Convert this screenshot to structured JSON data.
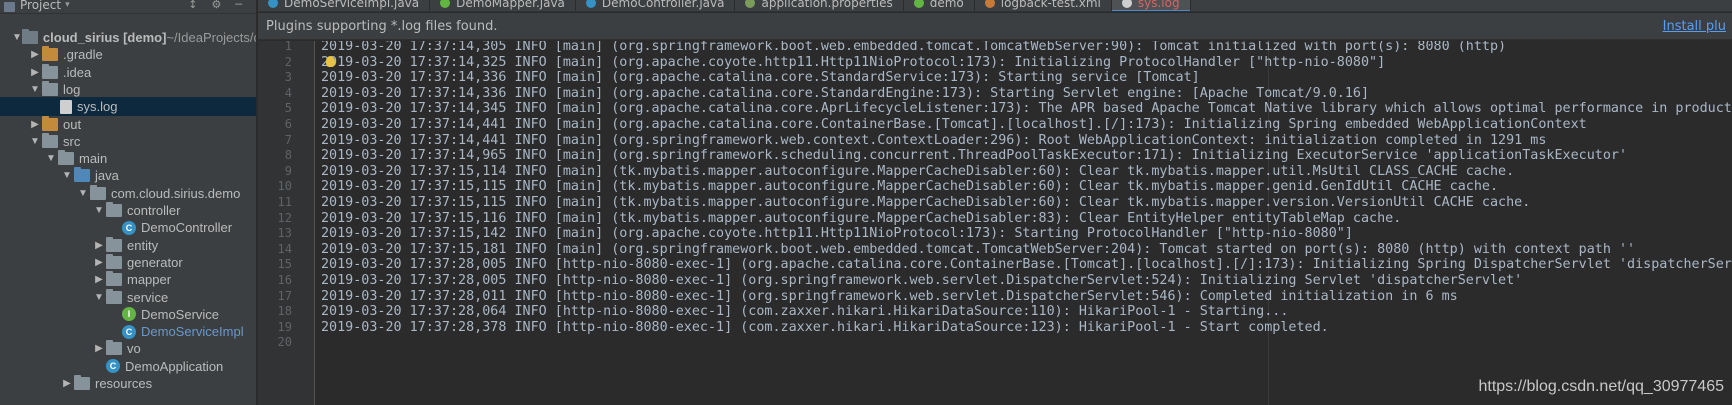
{
  "project_panel": {
    "title": "Project",
    "caret": "▾",
    "tools": [
      "↕",
      "⚙",
      "─"
    ],
    "tree": [
      {
        "depth": 0,
        "arrow": "down",
        "icon": "folder-dark-icon",
        "label": "cloud_sirius [demo]",
        "suffix": " ~/IdeaProjects/clo",
        "style": "bold"
      },
      {
        "depth": 1,
        "arrow": "right",
        "icon": "folder-orange-icon",
        "label": ".gradle"
      },
      {
        "depth": 1,
        "arrow": "right",
        "icon": "folder-icon",
        "label": ".idea"
      },
      {
        "depth": 1,
        "arrow": "down",
        "icon": "folder-icon",
        "label": "log"
      },
      {
        "depth": 2,
        "arrow": "none",
        "icon": "log-file-icon",
        "label": "sys.log",
        "selected": true
      },
      {
        "depth": 1,
        "arrow": "right",
        "icon": "folder-orange-icon",
        "label": "out"
      },
      {
        "depth": 1,
        "arrow": "down",
        "icon": "folder-icon",
        "label": "src"
      },
      {
        "depth": 2,
        "arrow": "down",
        "icon": "folder-icon",
        "label": "main"
      },
      {
        "depth": 3,
        "arrow": "down",
        "icon": "folder-blue-icon",
        "label": "java"
      },
      {
        "depth": 4,
        "arrow": "down",
        "icon": "package-icon",
        "label": "com.cloud.sirius.demo"
      },
      {
        "depth": 5,
        "arrow": "down",
        "icon": "package-icon",
        "label": "controller"
      },
      {
        "depth": 6,
        "arrow": "none",
        "icon": "class-icon",
        "label": "DemoController"
      },
      {
        "depth": 5,
        "arrow": "right",
        "icon": "package-icon",
        "label": "entity"
      },
      {
        "depth": 5,
        "arrow": "right",
        "icon": "package-icon",
        "label": "generator"
      },
      {
        "depth": 5,
        "arrow": "right",
        "icon": "package-icon",
        "label": "mapper"
      },
      {
        "depth": 5,
        "arrow": "down",
        "icon": "package-icon",
        "label": "service"
      },
      {
        "depth": 6,
        "arrow": "none",
        "icon": "interface-icon",
        "label": "DemoService"
      },
      {
        "depth": 6,
        "arrow": "none",
        "icon": "class-icon",
        "label": "DemoServiceImpl",
        "style": "modified"
      },
      {
        "depth": 5,
        "arrow": "right",
        "icon": "package-icon",
        "label": "vo"
      },
      {
        "depth": 5,
        "arrow": "none",
        "icon": "spring-boot-class-icon",
        "label": "DemoApplication"
      },
      {
        "depth": 3,
        "arrow": "right",
        "icon": "folder-icon",
        "label": "resources"
      }
    ]
  },
  "tabs": [
    {
      "label": "DemoServiceImpl.java",
      "icon": "class-icon",
      "color": "#3592c4",
      "active": false
    },
    {
      "label": "DemoMapper.java",
      "icon": "interface-icon",
      "color": "#62b543",
      "active": false
    },
    {
      "label": "DemoController.java",
      "icon": "class-icon",
      "color": "#3592c4",
      "active": false
    },
    {
      "label": "application.properties",
      "icon": "properties-icon",
      "color": "#7b9b5a",
      "active": false
    },
    {
      "label": "demo",
      "icon": "run-config-icon",
      "color": "#62b543",
      "active": false
    },
    {
      "label": "logback-test.xml",
      "icon": "xml-icon",
      "color": "#c67a3a",
      "active": false
    },
    {
      "label": "sys.log",
      "icon": "log-file-icon",
      "color": "#cfcfcf",
      "active": true
    }
  ],
  "notification": {
    "message": "Plugins supporting *.log files found.",
    "action": "Install plu"
  },
  "editor": {
    "line_numbers": [
      "1",
      "2",
      "3",
      "4",
      "5",
      "6",
      "7",
      "8",
      "9",
      "10",
      "11",
      "12",
      "13",
      "14",
      "15",
      "16",
      "17",
      "18",
      "19",
      "20"
    ],
    "lines": [
      "2019-03-20 17:37:14,305 INFO [main] (org.springframework.boot.web.embedded.tomcat.TomcatWebServer:90): Tomcat initialized with port(s): 8080 (http)",
      "2019-03-20 17:37:14,325 INFO [main] (org.apache.coyote.http11.Http11NioProtocol:173): Initializing ProtocolHandler [\"http-nio-8080\"]",
      "2019-03-20 17:37:14,336 INFO [main] (org.apache.catalina.core.StandardService:173): Starting service [Tomcat]",
      "2019-03-20 17:37:14,336 INFO [main] (org.apache.catalina.core.StandardEngine:173): Starting Servlet engine: [Apache Tomcat/9.0.16]",
      "2019-03-20 17:37:14,345 INFO [main] (org.apache.catalina.core.AprLifecycleListener:173): The APR based Apache Tomcat Native library which allows optimal performance in productio",
      "2019-03-20 17:37:14,441 INFO [main] (org.apache.catalina.core.ContainerBase.[Tomcat].[localhost].[/]:173): Initializing Spring embedded WebApplicationContext",
      "2019-03-20 17:37:14,441 INFO [main] (org.springframework.web.context.ContextLoader:296): Root WebApplicationContext: initialization completed in 1291 ms",
      "2019-03-20 17:37:14,965 INFO [main] (org.springframework.scheduling.concurrent.ThreadPoolTaskExecutor:171): Initializing ExecutorService 'applicationTaskExecutor'",
      "2019-03-20 17:37:15,114 INFO [main] (tk.mybatis.mapper.autoconfigure.MapperCacheDisabler:60): Clear tk.mybatis.mapper.util.MsUtil CLASS_CACHE cache.",
      "2019-03-20 17:37:15,115 INFO [main] (tk.mybatis.mapper.autoconfigure.MapperCacheDisabler:60): Clear tk.mybatis.mapper.genid.GenIdUtil CACHE cache.",
      "2019-03-20 17:37:15,115 INFO [main] (tk.mybatis.mapper.autoconfigure.MapperCacheDisabler:60): Clear tk.mybatis.mapper.version.VersionUtil CACHE cache.",
      "2019-03-20 17:37:15,116 INFO [main] (tk.mybatis.mapper.autoconfigure.MapperCacheDisabler:83): Clear EntityHelper entityTableMap cache.",
      "2019-03-20 17:37:15,142 INFO [main] (org.apache.coyote.http11.Http11NioProtocol:173): Starting ProtocolHandler [\"http-nio-8080\"]",
      "2019-03-20 17:37:15,181 INFO [main] (org.springframework.boot.web.embedded.tomcat.TomcatWebServer:204): Tomcat started on port(s): 8080 (http) with context path ''",
      "2019-03-20 17:37:28,005 INFO [http-nio-8080-exec-1] (org.apache.catalina.core.ContainerBase.[Tomcat].[localhost].[/]:173): Initializing Spring DispatcherServlet 'dispatcherServ",
      "2019-03-20 17:37:28,005 INFO [http-nio-8080-exec-1] (org.springframework.web.servlet.DispatcherServlet:524): Initializing Servlet 'dispatcherServlet'",
      "2019-03-20 17:37:28,011 INFO [http-nio-8080-exec-1] (org.springframework.web.servlet.DispatcherServlet:546): Completed initialization in 6 ms",
      "2019-03-20 17:37:28,064 INFO [http-nio-8080-exec-1] (com.zaxxer.hikari.HikariDataSource:110): HikariPool-1 - Starting...",
      "2019-03-20 17:37:28,378 INFO [http-nio-8080-exec-1] (com.zaxxer.hikari.HikariDataSource:123): HikariPool-1 - Start completed.",
      ""
    ],
    "intention_bulb_line": 2
  },
  "watermark": "https://blog.csdn.net/qq_30977465",
  "colors": {
    "panel_bg": "#3c3f41",
    "editor_bg": "#2b2b2b",
    "gutter_bg": "#313335",
    "selection": "#0d293e",
    "link": "#589df6",
    "active_tab_text": "#d66565"
  }
}
